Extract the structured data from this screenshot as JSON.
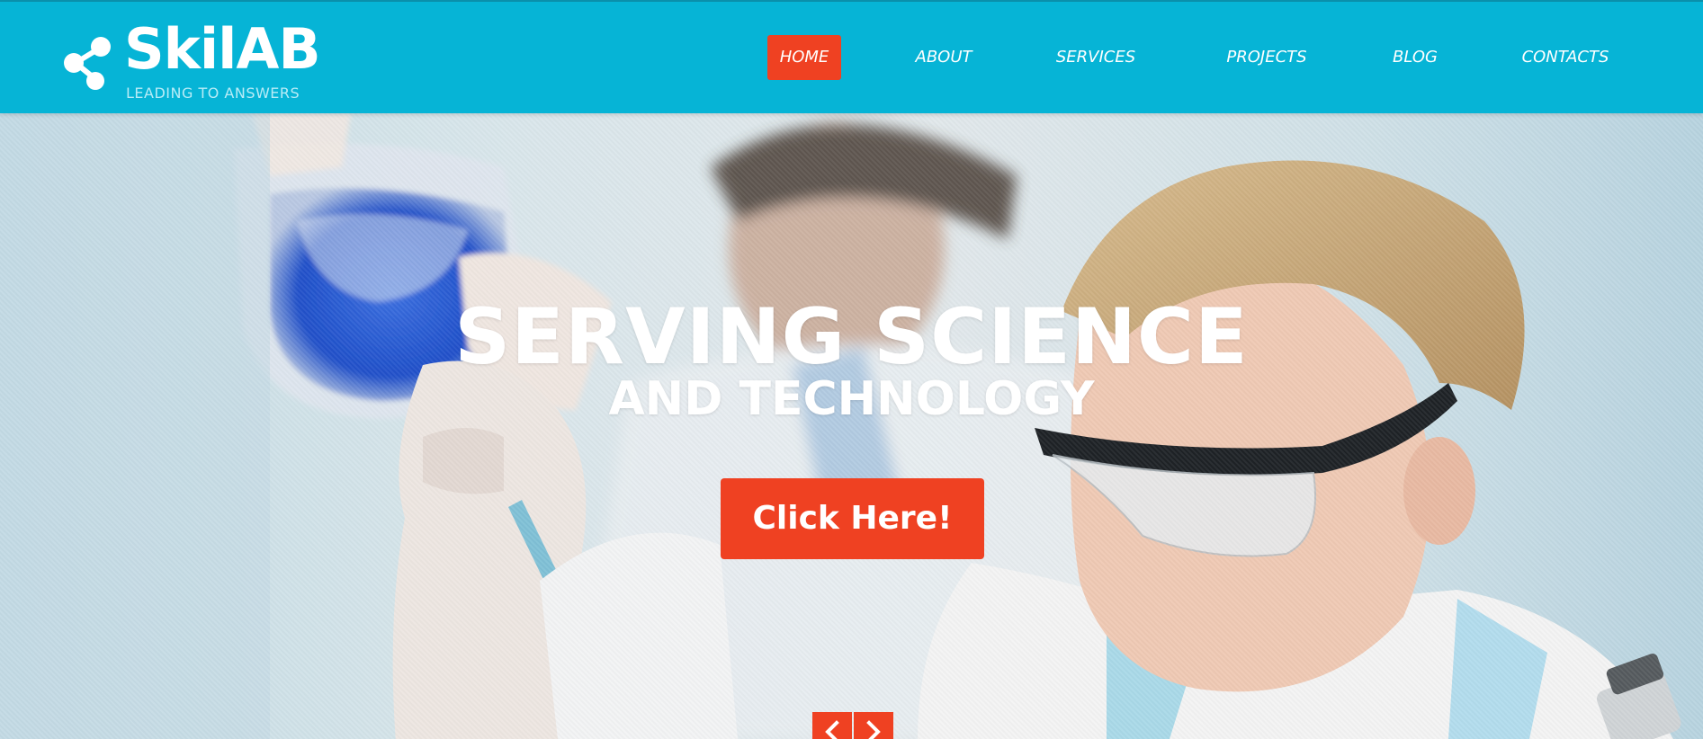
{
  "brand": {
    "name": "SkilAB",
    "tagline": "LEADING TO ANSWERS"
  },
  "nav": {
    "items": [
      {
        "label": "HOME",
        "active": true
      },
      {
        "label": "ABOUT",
        "active": false
      },
      {
        "label": "SERVICES",
        "active": false
      },
      {
        "label": "PROJECTS",
        "active": false
      },
      {
        "label": "BLOG",
        "active": false
      },
      {
        "label": "CONTACTS",
        "active": false
      }
    ]
  },
  "hero": {
    "title": "SERVING SCIENCE",
    "subtitle": "AND TECHNOLOGY",
    "cta_label": "Click Here!",
    "prev_icon": "chevron-left-icon",
    "next_icon": "chevron-right-icon"
  },
  "colors": {
    "header_bg": "#06b4d6",
    "accent": "#ef4122",
    "text_light": "#ffffff"
  }
}
